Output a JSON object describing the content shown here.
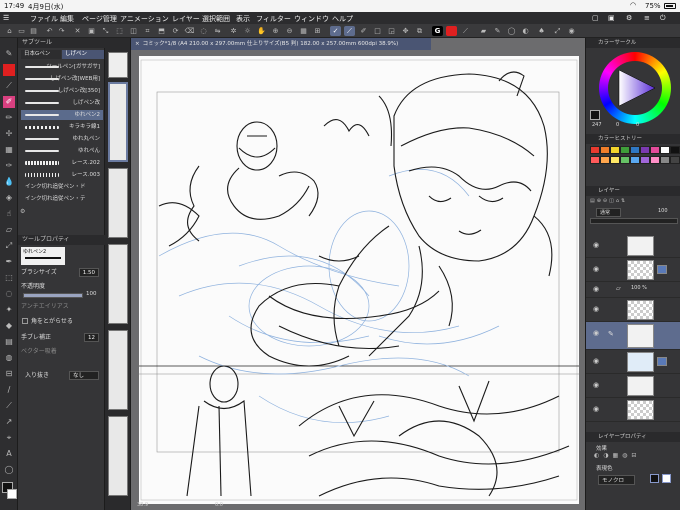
{
  "status": {
    "time": "17:49",
    "date": "4月9日(水)",
    "battery": "75%"
  },
  "menu": [
    "ファイル",
    "編集",
    "ページ管理",
    "アニメーション",
    "レイヤー",
    "選択範囲",
    "表示",
    "フィルター",
    "ウィンドウ",
    "ヘルプ"
  ],
  "subtool": {
    "header": "サブツール",
    "tab_active": "しげペン",
    "tab_other": "日本Gペン",
    "brushes": [
      "ツールペン[ガサガサ]",
      "しげペン改[WEB用]",
      "しげペン改[350]",
      "しげペン改",
      "ゆれペン2",
      "キラキラ線1",
      "ゆれ丸ペン",
      "ゆれぺん",
      "レース.202",
      "レース.003",
      "インク切れ追従ペン・ド",
      "インク切れ追従ペン・テ"
    ]
  },
  "tool_property": {
    "header": "ツールプロパティ",
    "tool_name": "ゆれペン2",
    "brush_size_label": "ブラシサイズ",
    "brush_size_value": "1.50",
    "opacity_label": "不透明度",
    "opacity_value": "100",
    "antialias_label": "アンチエイリアス",
    "corner_label": "角をとがらせる",
    "stabilization_label": "手ブレ補正",
    "stabilization_value": "12",
    "vector_label": "ベクター吸着",
    "entry_label": "入り抜き",
    "entry_value": "なし"
  },
  "document_tab": "コミック*1/8 (A4 210.00 x 297.00mm 仕上りサイズ(B5 判) 182.00 x 257.00mm 600dpi 38.9%)",
  "canvas_footer": {
    "zoom": "38.9",
    "angle": "0.0"
  },
  "right_panel": {
    "color_circle_header": "カラーサークル",
    "color_history_header": "カラーヒストリー",
    "layer_header": "レイヤー",
    "blend_mode": "通常",
    "opacity": "100",
    "folder_opacity": "100 %",
    "layer_property_header": "レイヤープロパティ",
    "effect_label": "効果",
    "expression_color_label": "表現色",
    "expression_color_value": "モノクロ",
    "hsv_values": [
      "247",
      "0",
      "0"
    ]
  },
  "colors": {
    "accent": "#4a5573",
    "selection": "#5e6c8e",
    "main_color": "#111111",
    "swatches": [
      "#e83a2f",
      "#f07e2a",
      "#f2d42c",
      "#3f9e3a",
      "#2f78c4",
      "#7b3ab2",
      "#e44b9a",
      "#ffffff",
      "#111111",
      "#ff5a5a",
      "#ffa64d",
      "#ffe866",
      "#66c266",
      "#5aa8f0",
      "#a066d9",
      "#ff8fc7",
      "#888888",
      "#444444"
    ]
  }
}
